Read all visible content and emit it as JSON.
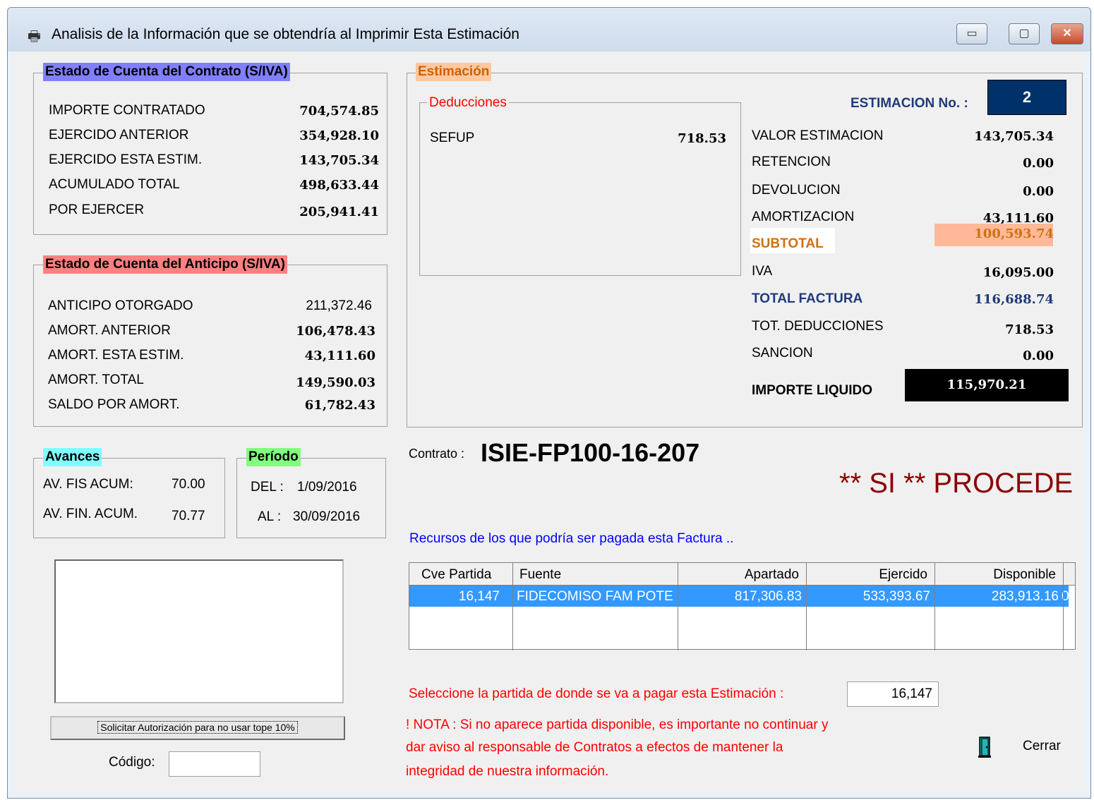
{
  "window": {
    "title": "Analisis de la Información que se obtendría al Imprimir Esta Estimación",
    "minimize_label": "▭",
    "maximize_label": "▢",
    "close_label": "✕"
  },
  "contrato_panel": {
    "legend": "Estado de Cuenta del Contrato (S/IVA)",
    "rows": [
      {
        "label": "IMPORTE CONTRATADO",
        "value": "704,574.85"
      },
      {
        "label": "EJERCIDO ANTERIOR",
        "value": "354,928.10"
      },
      {
        "label": "EJERCIDO ESTA ESTIM.",
        "value": "143,705.34"
      },
      {
        "label": "ACUMULADO TOTAL",
        "value": "498,633.44"
      },
      {
        "label": "POR EJERCER",
        "value": "205,941.41"
      }
    ]
  },
  "anticipo_panel": {
    "legend": "Estado de Cuenta del Anticipo (S/IVA)",
    "rows": [
      {
        "label": "ANTICIPO OTORGADO",
        "value": "211,372.46"
      },
      {
        "label": "AMORT. ANTERIOR",
        "value": "106,478.43"
      },
      {
        "label": "AMORT. ESTA ESTIM.",
        "value": "43,111.60"
      },
      {
        "label": "AMORT. TOTAL",
        "value": "149,590.03"
      },
      {
        "label": "SALDO POR AMORT.",
        "value": "61,782.43"
      }
    ]
  },
  "avances": {
    "legend": "Avances",
    "fis_label": "AV. FIS ACUM:",
    "fis_value": "70.00",
    "fin_label": "AV. FIN. ACUM.",
    "fin_value": "70.77"
  },
  "periodo": {
    "legend": "Período",
    "del_label": "DEL :",
    "del_value": "1/09/2016",
    "al_label": "AL :",
    "al_value": "30/09/2016"
  },
  "autorizacion": {
    "button_label": "Solicitar Autorización para no usar tope 10%",
    "codigo_label": "Código:",
    "codigo_value": ""
  },
  "estimacion": {
    "legend": "Estimación",
    "deducciones_legend": "Deducciones",
    "deducciones": [
      {
        "label": "SEFUP",
        "value": "718.53"
      }
    ],
    "numero_label": "ESTIMACION No. :",
    "numero_value": "2",
    "valor_label": "VALOR ESTIMACION",
    "valor_value": "143,705.34",
    "retencion_label": "RETENCION",
    "retencion_value": "0.00",
    "devolucion_label": "DEVOLUCION",
    "devolucion_value": "0.00",
    "amortizacion_label": "AMORTIZACION",
    "amortizacion_value": "43,111.60",
    "subtotal_label": "SUBTOTAL",
    "subtotal_value": "100,593.74",
    "iva_label": "IVA",
    "iva_value": "16,095.00",
    "total_factura_label": "TOTAL FACTURA",
    "total_factura_value": "116,688.74",
    "tot_deducciones_label": "TOT. DEDUCCIONES",
    "tot_deducciones_value": "718.53",
    "sancion_label": "SANCION",
    "sancion_value": "0.00",
    "importe_liquido_label": "IMPORTE LIQUIDO",
    "importe_liquido_value": "115,970.21"
  },
  "contrato": {
    "label": "Contrato :",
    "value": "ISIE-FP100-16-207",
    "status": "** SI ** PROCEDE"
  },
  "recursos": {
    "caption": "Recursos de los que podría ser pagada esta Factura ..",
    "columns": [
      "Cve Partida",
      "Fuente",
      "Apartado",
      "Ejercido",
      "Disponible"
    ],
    "rows": [
      {
        "cve": "16,147",
        "fuente": "FIDECOMISO FAM POTE",
        "apartado": "817,306.83",
        "ejercido": "533,393.67",
        "disponible": "283,913.16",
        "extra": "0"
      }
    ]
  },
  "seleccion": {
    "label": "Seleccione la partida de donde se va a pagar esta Estimación :",
    "value": "16,147"
  },
  "nota": {
    "line1": "! NOTA : Si no aparece partida disponible, es importante no continuar y",
    "line2": "dar aviso al responsable de Contratos a efectos de mantener la",
    "line3": "integridad de nuestra información."
  },
  "cerrar": {
    "label": "Cerrar",
    "icon": "door-exit-icon"
  },
  "colors": {
    "contrato_legend_bg": "#8080ff",
    "anticipo_legend_bg": "#ff8080",
    "estimacion_legend_bg": "#ffc8a0",
    "avances_legend_bg": "#80ffff",
    "periodo_legend_bg": "#80ff80",
    "subtotal_bg": "#ffb999",
    "numero_bg": "#00316b",
    "selection_bg": "#3399ff",
    "procede_color": "#8b0000"
  }
}
